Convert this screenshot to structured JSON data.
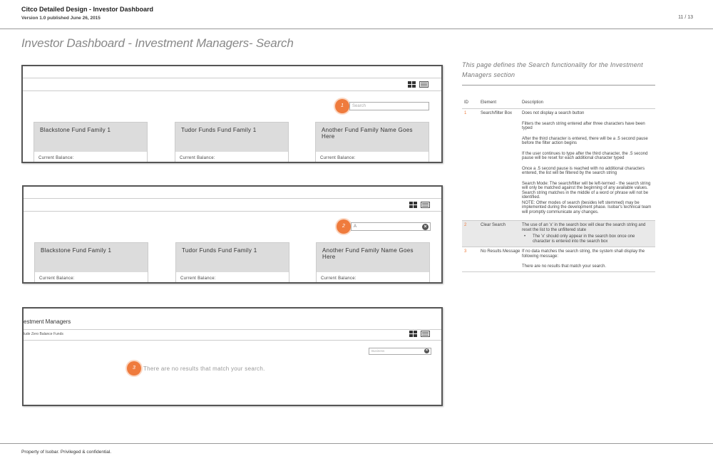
{
  "header": {
    "title": "Citco Detailed Design - Investor Dashboard",
    "version": "Version 1.0 published June 26, 2015",
    "page": "11 / 13"
  },
  "page_title": "Investor Dashboard - Investment Managers- Search",
  "mock1": {
    "marker": "1",
    "search_placeholder": "Search",
    "cards": [
      {
        "name": "Blackstone Fund Family 1",
        "balance": "Current Balance:"
      },
      {
        "name": "Tudor Funds Fund Family 1",
        "balance": "Current Balance:"
      },
      {
        "name": "Another Fund Family Name Goes Here",
        "balance": "Current Balance:"
      }
    ]
  },
  "mock2": {
    "marker": "2",
    "search_value": "A",
    "clear_glyph": "×",
    "cards": [
      {
        "name": "Blackstone Fund Family 1",
        "balance": "Current Balance:"
      },
      {
        "name": "Tudor Funds Fund Family 1",
        "balance": "Current Balance:"
      },
      {
        "name": "Another Fund Family Name Goes Here",
        "balance": "Current Balance:"
      }
    ]
  },
  "mock3": {
    "title": "estment Managers",
    "subtitle": "lude Zero Balance Funds",
    "marker": "3",
    "search_value": "Business",
    "clear_glyph": "×",
    "no_results": "There are no results that match your search."
  },
  "intro": "This page defines the Search functionality for the Investment Managers section",
  "table": {
    "headers": {
      "id": "ID",
      "element": "Element",
      "description": "Description"
    },
    "rows": [
      {
        "id": "1",
        "element": "Search/filter Box",
        "paras": [
          "Does not display a search button",
          "Filters the search string entered after three characters have been typed",
          "After the third character is entered, there will be a .5 second pause before the filter action begins",
          "If the user continues to type after the third character, the .5 second pause will be reset for each additional character typed",
          "Once a .5 second pause is reached with no additional characters entered, the list will be filtered by the search string",
          "Search Mode: The search/filter will be left-termed - the search string will only be matched against the beginning of any available values. Search string matches in the middle of a word or phrase will not be identified.",
          "NOTE: Other modes of search (besides left stemmed) may be implemented during the development phase. Isobar's technical team will promptly communicate any changes."
        ]
      },
      {
        "id": "2",
        "element": "Clear Search",
        "paras": [
          "The use of an 'x' in the search box will clear the search string and reset the list to the unfiltered state"
        ],
        "bullets": [
          "The 'x' should only appear in the search box once one character is entered into the search box"
        ]
      },
      {
        "id": "3",
        "element": "No Results Message",
        "paras": [
          "If no data matches the search string, the system shall display the following message:",
          "There are no results that match your search."
        ]
      }
    ]
  },
  "footer": "Property of Isobar. Privileged & confidential."
}
